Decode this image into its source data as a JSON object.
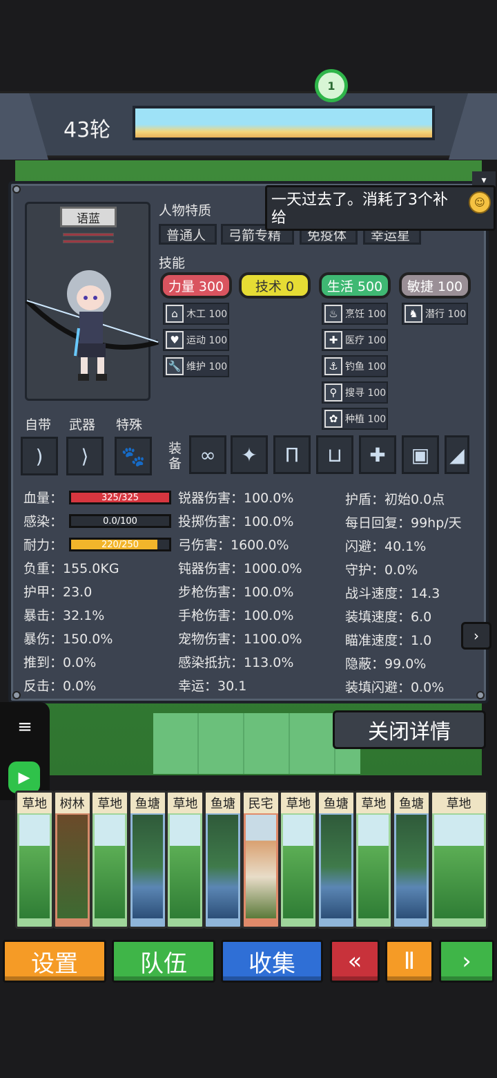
{
  "header": {
    "round": "43轮",
    "marker": "1"
  },
  "tooltip": {
    "text": "一天过去了。消耗了3个补给"
  },
  "character": {
    "name": "语蓝"
  },
  "traits": {
    "title": "人物特质",
    "items": [
      "普通人",
      "弓箭专精",
      "免疫体",
      "幸运星"
    ]
  },
  "skills": {
    "title": "技能",
    "main": [
      {
        "label": "力量 300",
        "color": "#d9545f"
      },
      {
        "label": "技术 0",
        "color": "#e6dc34"
      },
      {
        "label": "生活 500",
        "color": "#3fb873"
      },
      {
        "label": "敏捷 100",
        "color": "#9a8f96"
      }
    ],
    "sub": [
      {
        "label": "木工 100",
        "icon": "house-icon",
        "glyph": "⌂"
      },
      {
        "label": "运动 100",
        "icon": "heart-icon",
        "glyph": "♥"
      },
      {
        "label": "维护 100",
        "icon": "wrench-icon",
        "glyph": "🔧"
      },
      {
        "label": "烹饪 100",
        "icon": "pot-icon",
        "glyph": "♨"
      },
      {
        "label": "医疗 100",
        "icon": "medkit-icon",
        "glyph": "✚"
      },
      {
        "label": "钓鱼 100",
        "icon": "fish-icon",
        "glyph": "⚓"
      },
      {
        "label": "搜寻 100",
        "icon": "magnifier-icon",
        "glyph": "⚲"
      },
      {
        "label": "种植 100",
        "icon": "flower-icon",
        "glyph": "✿"
      },
      {
        "label": "潜行 100",
        "icon": "sneak-icon",
        "glyph": "♞"
      }
    ]
  },
  "slots": {
    "labels": [
      "自带",
      "武器",
      "特殊"
    ],
    "equipment_label": "装备"
  },
  "vitals": [
    {
      "label": "血量：",
      "text": "325/325",
      "fraction": 1.0,
      "color": "#d6363f"
    },
    {
      "label": "感染：",
      "text": "0.0/100",
      "fraction": 0.0,
      "color": "#59606b"
    },
    {
      "label": "耐力：",
      "text": "220/250",
      "fraction": 0.88,
      "color": "#f2b52b"
    }
  ],
  "stats_left": [
    "负重：155.0KG",
    "护甲：23.0",
    "暴击：32.1%",
    "暴伤：150.0%",
    "推到：0.0%",
    "反击：0.0%"
  ],
  "stats_mid": [
    "锐器伤害：100.0%",
    "投掷伤害：100.0%",
    "弓伤害：1600.0%",
    "钝器伤害：1000.0%",
    "步枪伤害：100.0%",
    "手枪伤害：100.0%",
    "宠物伤害：1100.0%",
    "感染抵抗：113.0%",
    "幸运：30.1"
  ],
  "stats_right": [
    "护盾：初始0.0点",
    "每日回复：99hp/天",
    "闪避：40.1%",
    "守护：0.0%",
    "战斗速度：14.3",
    "装填速度：6.0",
    "瞄准速度：1.0",
    "隐蔽：99.0%",
    "装填闪避：0.0%"
  ],
  "close_button": "关闭详情",
  "cards": [
    "草地",
    "树林",
    "草地",
    "鱼塘",
    "草地",
    "鱼塘",
    "民宅",
    "草地",
    "鱼塘",
    "草地",
    "鱼塘",
    "草地"
  ],
  "bottom": {
    "settings": "设置",
    "team": "队伍",
    "collect": "收集",
    "rewind": "«",
    "pause": "Ⅱ",
    "play": "›"
  }
}
